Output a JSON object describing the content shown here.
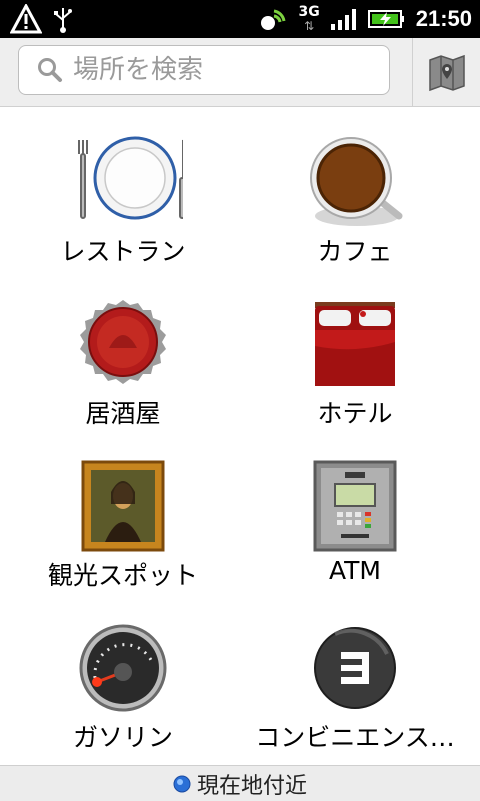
{
  "status": {
    "network": "3G",
    "time": "21:50"
  },
  "search": {
    "placeholder": "場所を検索"
  },
  "categories": [
    {
      "label": "レストラン",
      "icon": "plate-icon"
    },
    {
      "label": "カフェ",
      "icon": "coffee-cup-icon"
    },
    {
      "label": "居酒屋",
      "icon": "bottle-cap-icon"
    },
    {
      "label": "ホテル",
      "icon": "bed-icon"
    },
    {
      "label": "観光スポット",
      "icon": "painting-icon"
    },
    {
      "label": "ATM",
      "icon": "atm-icon"
    },
    {
      "label": "ガソリン",
      "icon": "fuel-gauge-icon"
    },
    {
      "label": "コンビニエンス…",
      "icon": "convenience-store-icon"
    }
  ],
  "footer": {
    "label": "現在地付近"
  },
  "colors": {
    "accent": "#2a6fd6",
    "status_bg": "#000000"
  }
}
